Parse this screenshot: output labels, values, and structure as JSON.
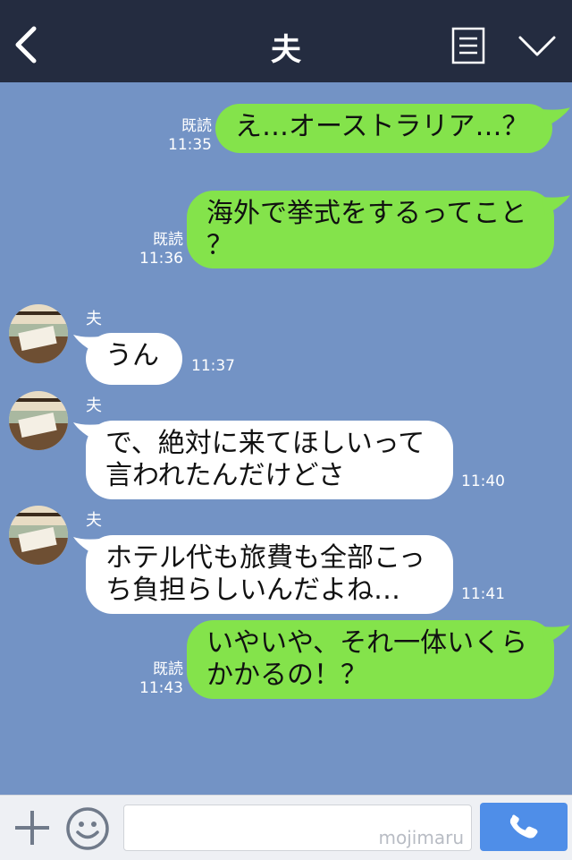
{
  "header": {
    "title": "夫",
    "back_icon": "chevron-left-icon",
    "menu_icon": "document-list-icon",
    "expand_icon": "chevron-down-icon"
  },
  "messages": [
    {
      "side": "right",
      "lines": [
        "え…オーストラリア…？"
      ],
      "read": "既読",
      "time": "11:35"
    },
    {
      "side": "right",
      "lines": [
        "海外で挙式をするってこと",
        "？"
      ],
      "read": "既読",
      "time": "11:36"
    },
    {
      "side": "left",
      "sender": "夫",
      "lines": [
        "うん"
      ],
      "time": "11:37"
    },
    {
      "side": "left",
      "sender": "夫",
      "lines": [
        "で、絶対に来てほしいって",
        "言われたんだけどさ"
      ],
      "time": "11:40"
    },
    {
      "side": "left",
      "sender": "夫",
      "lines": [
        "ホテル代も旅費も全部こっ",
        "ち負担らしいんだよね…"
      ],
      "time": "11:41"
    },
    {
      "side": "right",
      "lines": [
        "いやいや、それ一体いくら",
        "かかるの！？"
      ],
      "read": "既読",
      "time": "11:43"
    }
  ],
  "input": {
    "placeholder": "",
    "watermark": "mojimaru",
    "plus_icon": "plus-icon",
    "emoji_icon": "smiley-icon",
    "send_icon": "phone-icon"
  },
  "colors": {
    "background": "#7393c5",
    "header": "#242c40",
    "outgoing_bubble": "#84e34b",
    "incoming_bubble": "#ffffff",
    "call_button": "#4f8ee8"
  }
}
